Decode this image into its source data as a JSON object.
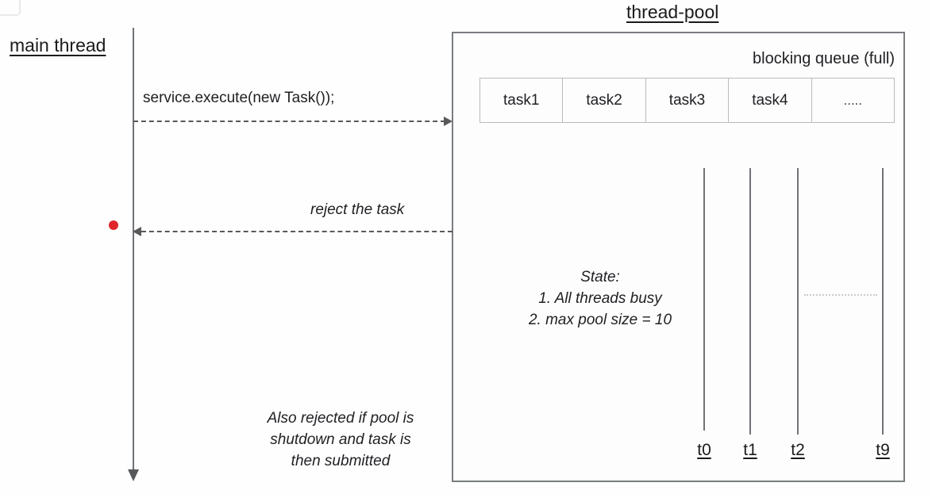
{
  "diagram": {
    "main_thread_label": "main thread",
    "pool_title": "thread-pool",
    "queue": {
      "label": "blocking queue (full)",
      "cells": [
        "task1",
        "task2",
        "task3",
        "task4",
        "....."
      ]
    },
    "messages": [
      {
        "caption": "service.execute(new Task());",
        "direction": "right"
      },
      {
        "caption": "reject the task",
        "direction": "left"
      }
    ],
    "state": {
      "title": "State:",
      "items": [
        "1. All threads busy",
        "2. max pool size = 10"
      ]
    },
    "note": {
      "line1": "Also rejected if pool is",
      "line2": "shutdown and task is",
      "line3": "then submitted"
    },
    "workers": [
      {
        "label": "t0"
      },
      {
        "label": "t1"
      },
      {
        "label": "t2"
      },
      {
        "label": "t9"
      }
    ],
    "colors": {
      "cursor_dot": "#e0252b",
      "line": "#6f7276",
      "box_border": "#7a7d80",
      "text": "#202124",
      "queue_border": "#b9bbbd",
      "gap_dots": "#c9cbcd",
      "background": "#fefefe"
    }
  }
}
